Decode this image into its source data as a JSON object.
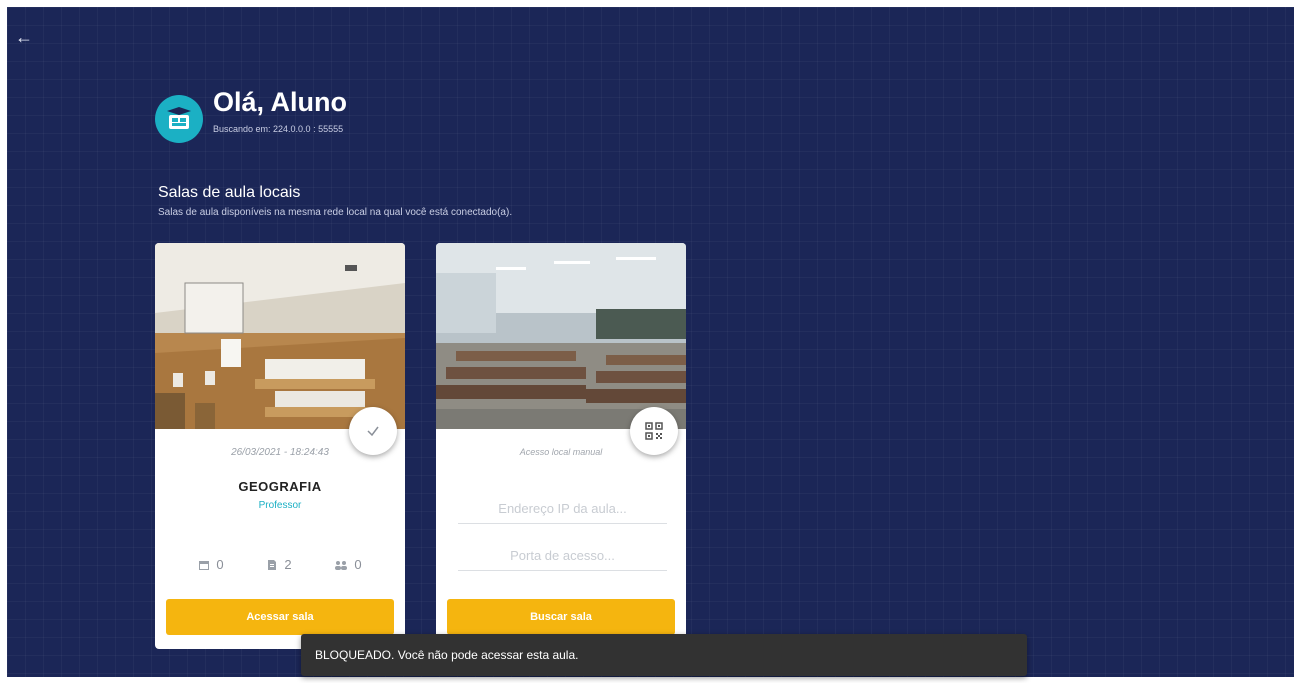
{
  "header": {
    "back_icon": "arrow-left-icon",
    "greeting": "Olá, Aluno",
    "searching": "Buscando em: 224.0.0.0 : 55555",
    "logo_icon": "classroom-graduation-cap-icon"
  },
  "section": {
    "title": "Salas de aula locais",
    "subtitle": "Salas de aula disponíveis na mesma rede local na qual você está conectado(a)."
  },
  "rooms": [
    {
      "status_icon": "check-icon",
      "date": "26/03/2021 - 18:24:43",
      "subject": "GEOGRAFIA",
      "teacher": "Professor",
      "stats": [
        {
          "icon": "calendar-icon",
          "value": "0"
        },
        {
          "icon": "file-icon",
          "value": "2"
        },
        {
          "icon": "people-icon",
          "value": "0"
        }
      ],
      "button_label": "Acessar sala"
    }
  ],
  "manual": {
    "qr_icon": "qr-code-icon",
    "label": "Acesso local manual",
    "ip_placeholder": "Endereço IP da aula...",
    "port_placeholder": "Porta de acesso...",
    "button_label": "Buscar sala"
  },
  "snackbar": {
    "message": "BLOQUEADO. Você não pode acessar esta aula."
  },
  "colors": {
    "background": "#1b2657",
    "accent_teal": "#1bb0c4",
    "button_yellow": "#f5b50f"
  }
}
